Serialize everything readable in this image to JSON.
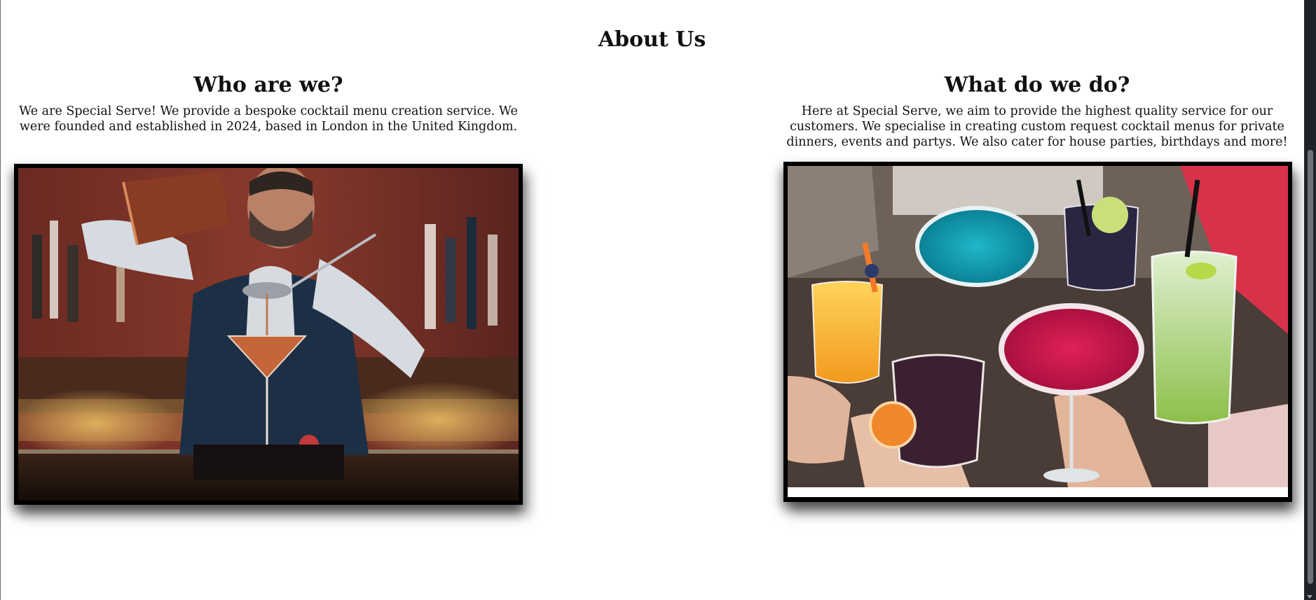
{
  "page": {
    "title": "About Us"
  },
  "sections": [
    {
      "heading": "Who are we?",
      "text": "We are Special Serve! We provide a bespoke cocktail menu creation service. We were founded and established in 2024, based in London in the United Kingdom.",
      "image_description": "Bartender straining a cocktail into a martini glass at a bar"
    },
    {
      "heading": "What do we do?",
      "text": "Here at Special Serve, we aim to provide the highest quality service for our customers. We specialise in creating custom request cocktail menus for private dinners, events and partys. We also cater for house parties, birthdays and more!",
      "image_description": "Friends toasting with colorful cocktails"
    }
  ],
  "colors": {
    "background": "#ffffff",
    "text": "#111111",
    "frame": "#000000",
    "scrollbar": "#1f2329"
  }
}
